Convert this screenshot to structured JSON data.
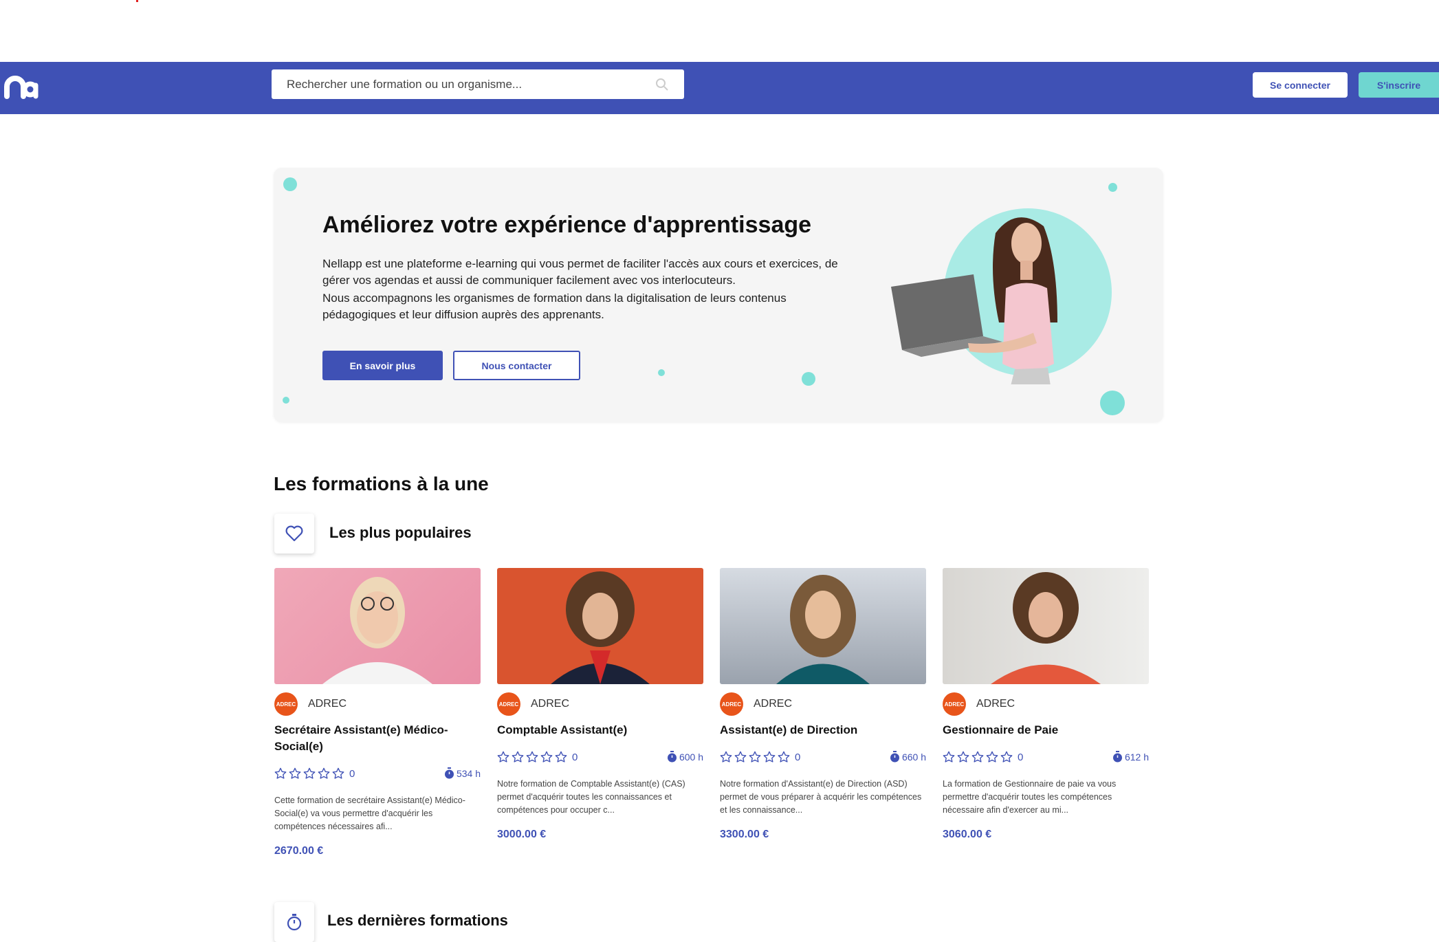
{
  "header": {
    "search_placeholder": "Rechercher une formation ou un organisme...",
    "login_label": "Se connecter",
    "signup_label": "S'inscrire"
  },
  "hero": {
    "title": "Améliorez votre expérience d'apprentissage",
    "paragraph1": "Nellapp est une plateforme e-learning qui vous permet de faciliter l'accès aux cours et exercices, de gérer vos agendas et aussi de communiquer facilement avec vos interlocuteurs.",
    "paragraph2": "Nous accompagnons les organismes de formation dans la digitalisation de leurs contenus pédagogiques et leur diffusion auprès des apprenants.",
    "more_label": "En savoir plus",
    "contact_label": "Nous contacter"
  },
  "featured": {
    "title": "Les formations à la une",
    "popular_title": "Les plus populaires",
    "latest_title": "Les dernières formations"
  },
  "courses": [
    {
      "org": "ADREC",
      "org_logo_text": "ADREC",
      "title": "Secrétaire Assistant(e) Médico-Social(e)",
      "rating": "0",
      "duration": "534 h",
      "description": "Cette formation de secrétaire Assistant(e) Médico-Social(e) va vous permettre d'acquérir les compétences nécessaires afi...",
      "price": "2670.00 €"
    },
    {
      "org": "ADREC",
      "org_logo_text": "ADREC",
      "title": "Comptable Assistant(e)",
      "rating": "0",
      "duration": "600 h",
      "description": "Notre formation de Comptable Assistant(e) (CAS) permet d'acquérir toutes les connaissances et compétences pour occuper c...",
      "price": "3000.00 €"
    },
    {
      "org": "ADREC",
      "org_logo_text": "ADREC",
      "title": "Assistant(e) de Direction",
      "rating": "0",
      "duration": "660 h",
      "description": "Notre formation d'Assistant(e) de Direction (ASD) permet de vous préparer à acquérir les compétences et les connaissance...",
      "price": "3300.00 €"
    },
    {
      "org": "ADREC",
      "org_logo_text": "ADREC",
      "title": "Gestionnaire de Paie",
      "rating": "0",
      "duration": "612 h",
      "description": "La formation de Gestionnaire de paie va vous permettre d'acquérir toutes les compétences nécessaire afin d'exercer au mi...",
      "price": "3060.00 €"
    }
  ],
  "colors": {
    "brand": "#3f51b5",
    "accent": "#6fd6d0",
    "hero_bg": "#f5f5f5"
  }
}
